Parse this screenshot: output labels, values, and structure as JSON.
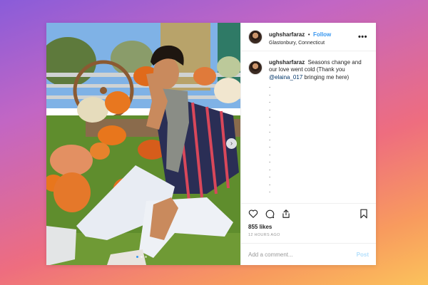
{
  "post": {
    "username": "ughsharfaraz",
    "separator": "•",
    "follow_label": "Follow",
    "location": "Glastonbury, Connecticut",
    "more_icon": "more-options-icon",
    "caption": {
      "username": "ughsharfaraz",
      "text_before": "Seasons change and our love went cold (Thank you ",
      "mention": "@elaina_017",
      "text_after": " bringing me here)",
      "dot_lines": [
        ".",
        ".",
        ".",
        ".",
        ".",
        ".",
        ".",
        ".",
        ".",
        ".",
        ".",
        ".",
        ".",
        ".",
        "."
      ]
    },
    "actions": {
      "icons": [
        "heart-icon",
        "comment-icon",
        "share-icon",
        "bookmark-icon"
      ]
    },
    "likes": "855 likes",
    "time_ago": "12 HOURS AGO",
    "comment": {
      "placeholder": "Add a comment...",
      "post_label": "Post"
    },
    "carousel": {
      "next_icon": "chevron-right-icon",
      "next_glyph": "›",
      "slide_count": 3,
      "active_slide": 1
    },
    "colors": {
      "link_blue": "#3897f0",
      "post_disabled": "#b2dffc",
      "mention": "#003569"
    }
  }
}
